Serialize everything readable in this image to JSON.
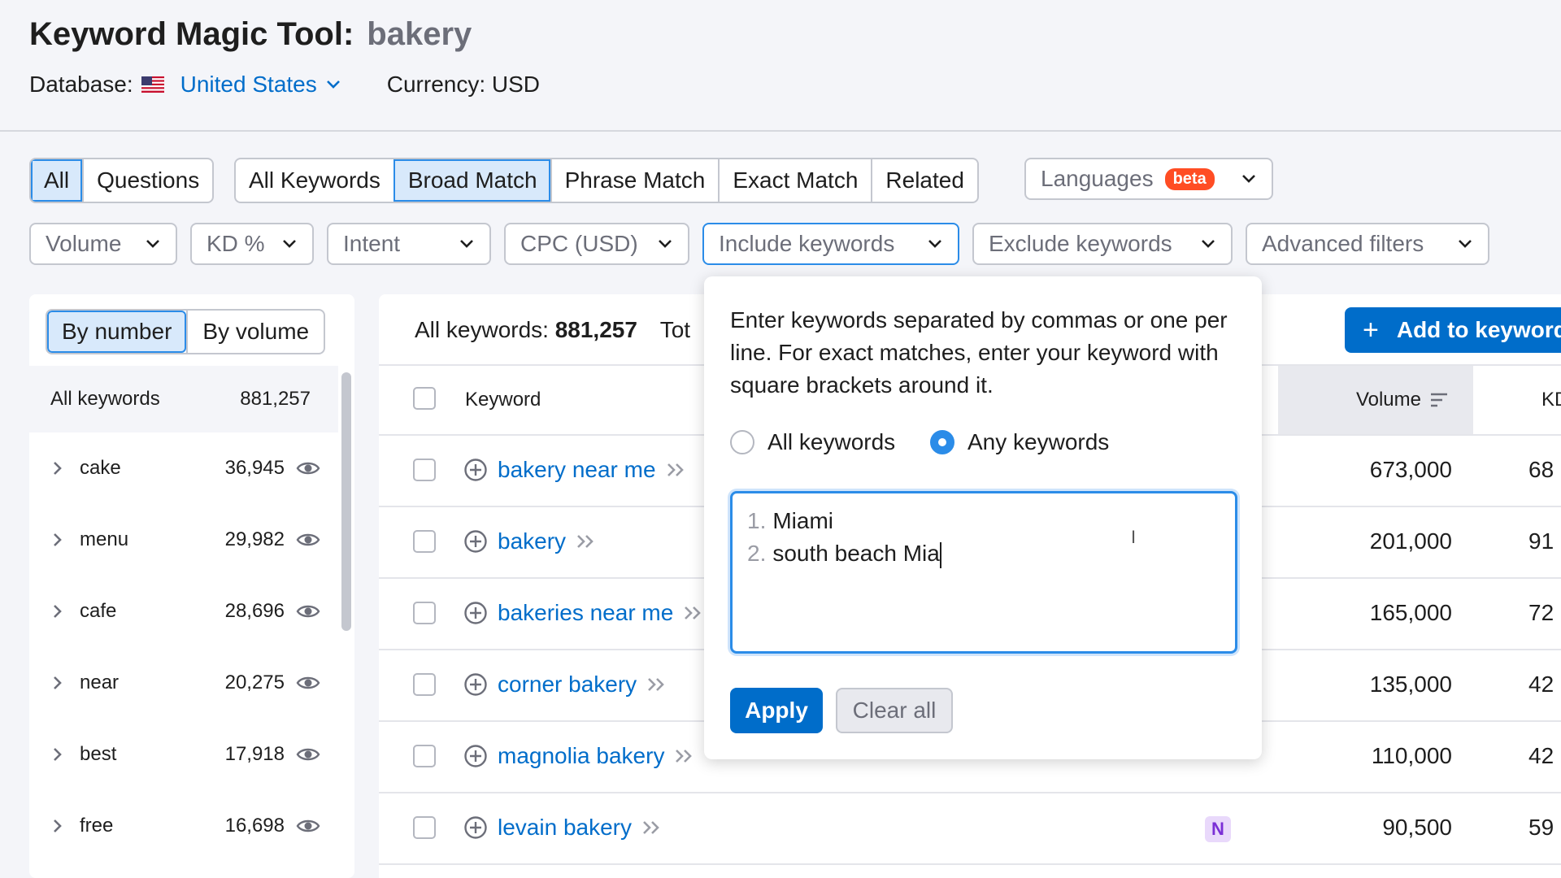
{
  "header": {
    "title": "Keyword Magic Tool:",
    "keyword": "bakery",
    "database_label": "Database:",
    "database_value": "United States",
    "currency": "Currency: USD"
  },
  "tabs": {
    "group1": [
      "All",
      "Questions"
    ],
    "group1_active": "All",
    "group2": [
      "All Keywords",
      "Broad Match",
      "Phrase Match",
      "Exact Match",
      "Related"
    ],
    "group2_active": "Broad Match",
    "languages": "Languages",
    "beta": "beta"
  },
  "filters": [
    "Volume",
    "KD %",
    "Intent",
    "CPC (USD)",
    "Include keywords",
    "Exclude keywords",
    "Advanced filters"
  ],
  "sidebar": {
    "sort_options": [
      "By number",
      "By volume"
    ],
    "sort_active": "By number",
    "all_label": "All keywords",
    "all_count": "881,257",
    "groups": [
      {
        "name": "cake",
        "count": "36,945"
      },
      {
        "name": "menu",
        "count": "29,982"
      },
      {
        "name": "cafe",
        "count": "28,696"
      },
      {
        "name": "near",
        "count": "20,275"
      },
      {
        "name": "best",
        "count": "17,918"
      },
      {
        "name": "free",
        "count": "16,698"
      }
    ]
  },
  "table": {
    "summary_label": "All keywords:",
    "summary_count": "881,257",
    "summary_tail": "Tot",
    "add_button": "Add to keyword",
    "col_keyword": "Keyword",
    "col_volume": "Volume",
    "col_kd": "KD",
    "rows": [
      {
        "keyword": "bakery near me",
        "volume": "673,000",
        "kd": "68",
        "intent": ""
      },
      {
        "keyword": "bakery",
        "volume": "201,000",
        "kd": "91",
        "intent": ""
      },
      {
        "keyword": "bakeries near me",
        "volume": "165,000",
        "kd": "72",
        "intent": ""
      },
      {
        "keyword": "corner bakery",
        "volume": "135,000",
        "kd": "42",
        "intent": ""
      },
      {
        "keyword": "magnolia bakery",
        "volume": "110,000",
        "kd": "42",
        "intent": ""
      },
      {
        "keyword": "levain bakery",
        "volume": "90,500",
        "kd": "59",
        "intent": "N"
      }
    ]
  },
  "popup": {
    "help_text": "Enter keywords separated by commas or one per line. For exact matches, enter your keyword with square brackets around it.",
    "radio_all": "All keywords",
    "radio_any": "Any keywords",
    "radio_selected": "Any keywords",
    "lines": [
      {
        "num": "1.",
        "text": "Miami"
      },
      {
        "num": "2.",
        "text": "south beach Mia"
      }
    ],
    "apply": "Apply",
    "clear": "Clear all"
  },
  "colors": {
    "accent": "#006dca",
    "active_tab": "#d8e9fb",
    "beta": "#ff4d24",
    "intent_navigational": "#e9d9fb"
  },
  "icons": [
    "us-flag-icon",
    "chevron-down-icon",
    "chevron-right-icon",
    "eye-icon",
    "plus-circle-icon",
    "double-chevron-icon",
    "sort-icon",
    "text-cursor-icon",
    "plus-icon"
  ]
}
